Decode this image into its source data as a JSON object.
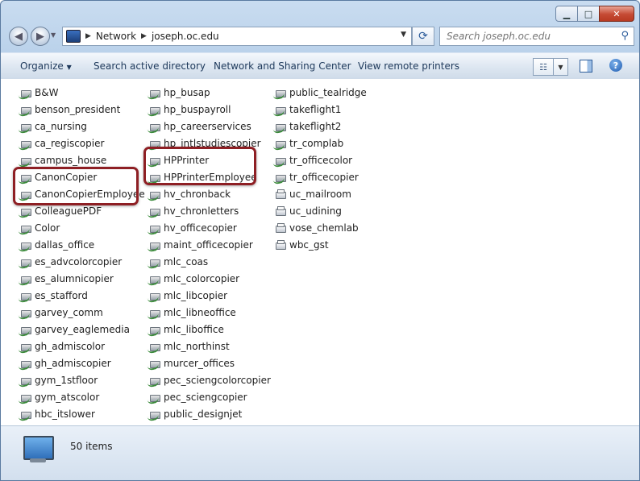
{
  "window": {
    "controls": {
      "minimize": "▁",
      "maximize": "□",
      "close": "✕"
    }
  },
  "navbar": {
    "back_icon": "back-arrow-icon",
    "forward_icon": "forward-arrow-icon",
    "breadcrumb": [
      "Network",
      "joseph.oc.edu"
    ],
    "search_placeholder": "Search joseph.oc.edu"
  },
  "toolbar": {
    "organize": "Organize",
    "search_ad": "Search active directory",
    "network_sharing": "Network and Sharing Center",
    "view_printers": "View remote printers"
  },
  "printers": {
    "columns": [
      [
        {
          "name": "B&W",
          "type": "network"
        },
        {
          "name": "benson_president",
          "type": "network"
        },
        {
          "name": "ca_nursing",
          "type": "network"
        },
        {
          "name": "ca_regiscopier",
          "type": "network"
        },
        {
          "name": "campus_house",
          "type": "network"
        },
        {
          "name": "CanonCopier",
          "type": "network"
        },
        {
          "name": "CanonCopierEmployee",
          "type": "network"
        },
        {
          "name": "ColleaguePDF",
          "type": "network"
        },
        {
          "name": "Color",
          "type": "network"
        },
        {
          "name": "dallas_office",
          "type": "network"
        },
        {
          "name": "es_advcolorcopier",
          "type": "network"
        },
        {
          "name": "es_alumnicopier",
          "type": "network"
        },
        {
          "name": "es_stafford",
          "type": "network"
        },
        {
          "name": "garvey_comm",
          "type": "network"
        },
        {
          "name": "garvey_eaglemedia",
          "type": "network"
        },
        {
          "name": "gh_admiscolor",
          "type": "network"
        },
        {
          "name": "gh_admiscopier",
          "type": "network"
        },
        {
          "name": "gym_1stfloor",
          "type": "network"
        },
        {
          "name": "gym_atscolor",
          "type": "network"
        },
        {
          "name": "hbc_itslower",
          "type": "network"
        }
      ],
      [
        {
          "name": "hp_busap",
          "type": "network"
        },
        {
          "name": "hp_buspayroll",
          "type": "network"
        },
        {
          "name": "hp_careerservices",
          "type": "network"
        },
        {
          "name": "hp_intlstudiescopier",
          "type": "network"
        },
        {
          "name": "HPPrinter",
          "type": "network"
        },
        {
          "name": "HPPrinterEmployee",
          "type": "network"
        },
        {
          "name": "hv_chronback",
          "type": "network"
        },
        {
          "name": "hv_chronletters",
          "type": "network"
        },
        {
          "name": "hv_officecopier",
          "type": "network"
        },
        {
          "name": "maint_officecopier",
          "type": "network"
        },
        {
          "name": "mlc_coas",
          "type": "network"
        },
        {
          "name": "mlc_colorcopier",
          "type": "network"
        },
        {
          "name": "mlc_libcopier",
          "type": "network"
        },
        {
          "name": "mlc_libneoffice",
          "type": "network"
        },
        {
          "name": "mlc_liboffice",
          "type": "network"
        },
        {
          "name": "mlc_northinst",
          "type": "network"
        },
        {
          "name": "murcer_offices",
          "type": "network"
        },
        {
          "name": "pec_sciengcolorcopier",
          "type": "network"
        },
        {
          "name": "pec_sciengcopier",
          "type": "network"
        },
        {
          "name": "public_designjet",
          "type": "network"
        }
      ],
      [
        {
          "name": "public_tealridge",
          "type": "network"
        },
        {
          "name": "takeflight1",
          "type": "network"
        },
        {
          "name": "takeflight2",
          "type": "network"
        },
        {
          "name": "tr_complab",
          "type": "network"
        },
        {
          "name": "tr_officecolor",
          "type": "network"
        },
        {
          "name": "tr_officecopier",
          "type": "network"
        },
        {
          "name": "uc_mailroom",
          "type": "local"
        },
        {
          "name": "uc_udining",
          "type": "local"
        },
        {
          "name": "vose_chemlab",
          "type": "local"
        },
        {
          "name": "wbc_gst",
          "type": "local"
        }
      ]
    ]
  },
  "status": {
    "count": "50 items"
  },
  "colors": {
    "highlight": "#8e1f24",
    "accent": "#1e395b"
  }
}
